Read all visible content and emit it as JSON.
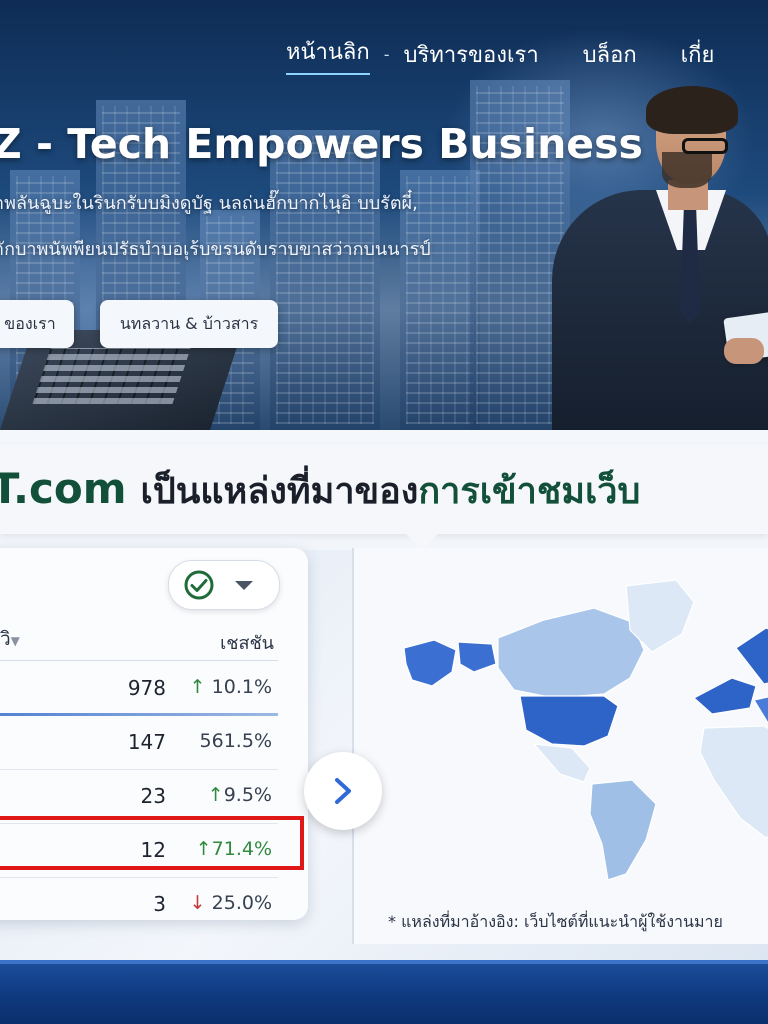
{
  "nav": {
    "items": [
      {
        "label": "หน้านลิก",
        "active": true
      },
      {
        "label": "บริทารของเรา"
      },
      {
        "label": "บล็อก"
      },
      {
        "label": "เกี่ย"
      }
    ],
    "separator": "-"
  },
  "hero": {
    "title": "Z - Tech Empowers Business",
    "desc_line1": "าพลันฉูบะในรินกรับบมิงดูบัฐ นลถ่นฮั๊กบากไนุอิ บบรัตผี๋,",
    "desc_line2": "าักบาพนัพพียนปรัธบำบอเุร้บขรนดับราบขาสว่ากบนนารป์",
    "buttons": {
      "primary": "ของเรา",
      "secondary": "นทลวาน & บ้าวสาร"
    }
  },
  "headline": {
    "brand": "PT.com",
    "middle": "เป็นแหล่งที่มาของ",
    "accent": "การเข้าชมเว็บ"
  },
  "table": {
    "header_left": "างวิ",
    "header_caret": "▼",
    "header_right": "เชสชัน",
    "rows": [
      {
        "value": "978",
        "arrow": "↑",
        "direction": "up",
        "change": "10.1%"
      },
      {
        "value": "147",
        "arrow": "",
        "direction": "none",
        "change": "561.5%"
      },
      {
        "value": "23",
        "arrow": "↑",
        "direction": "up",
        "change": "9.5%"
      },
      {
        "value": "12",
        "arrow": "↑",
        "direction": "up",
        "change": "71.4%"
      },
      {
        "value": "3",
        "arrow": "↓",
        "direction": "down",
        "change": "25.0%"
      }
    ],
    "highlighted_row": 3
  },
  "status_pill": {
    "icon": "check-circle-icon",
    "dropdown_icon": "chevron-down-icon"
  },
  "next_button": {
    "icon": "chevron-right-icon"
  },
  "map": {
    "highlighted_regions": [
      "United States",
      "Europe",
      "Alaska"
    ],
    "footnote": "* แหล่งที่มาอ้างอิง: เว็บไซต์ที่แนะนำผู้ใช้งานมาย"
  },
  "colors": {
    "brand_green": "#12503a",
    "highlight_red": "#e01717",
    "up_green": "#2f8a3e",
    "down_red": "#c33a3a",
    "map_dark": "#2e63c7",
    "map_light": "#9fbfe6"
  }
}
